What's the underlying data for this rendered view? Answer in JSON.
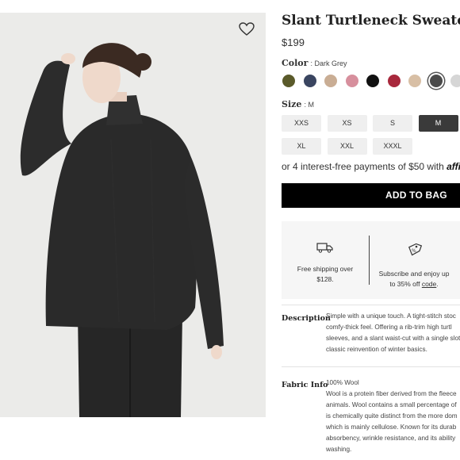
{
  "product": {
    "title": "Slant Turtleneck Sweater",
    "price": "$199"
  },
  "color": {
    "label": "Color",
    "selected": ": Dark Grey",
    "swatches": [
      {
        "name": "olive",
        "hex": "#5a5a2a"
      },
      {
        "name": "navy",
        "hex": "#3a4560"
      },
      {
        "name": "camel",
        "hex": "#c9ad94"
      },
      {
        "name": "pink",
        "hex": "#d78f9d"
      },
      {
        "name": "black",
        "hex": "#111111"
      },
      {
        "name": "burgundy",
        "hex": "#a8283c"
      },
      {
        "name": "beige",
        "hex": "#d8bfa5"
      },
      {
        "name": "dark-grey",
        "hex": "#4a4a4a",
        "selected": true
      },
      {
        "name": "light-grey",
        "hex": "#d6d6d6"
      }
    ]
  },
  "size": {
    "label": "Size",
    "selected": ": M",
    "options": [
      "XXS",
      "XS",
      "S",
      "M",
      "XL",
      "XXL",
      "XXXL"
    ]
  },
  "affirm": {
    "text": "or 4 interest-free payments of $50 with",
    "logo": "affirm"
  },
  "cta": {
    "add_to_bag": "ADD TO BAG"
  },
  "perks": {
    "shipping_line1": "Free shipping over",
    "shipping_line2": "$128.",
    "subscribe_line1": "Subscribe and enjoy up",
    "subscribe_line2_pre": "to 35% off ",
    "subscribe_link": "code",
    "subscribe_line2_post": "."
  },
  "description": {
    "label": "Description",
    "lines": [
      "Simple with a unique touch. A tight-stitch stoc",
      "comfy-thick feel. Offering a rib-trim high turtl",
      "sleeves, and a slant waist-cut with a single slot",
      "classic reinvention of winter basics."
    ]
  },
  "fabric": {
    "label": "Fabric Info",
    "lines": [
      "100% Wool",
      "Wool is a protein fiber derived from the fleece",
      "animals. Wool contains a small percentage of",
      "is chemically quite distinct from the more dom",
      "which is mainly cellulose. Known for its durab",
      "absorbency, wrinkle resistance, and its ability",
      "washing."
    ]
  }
}
